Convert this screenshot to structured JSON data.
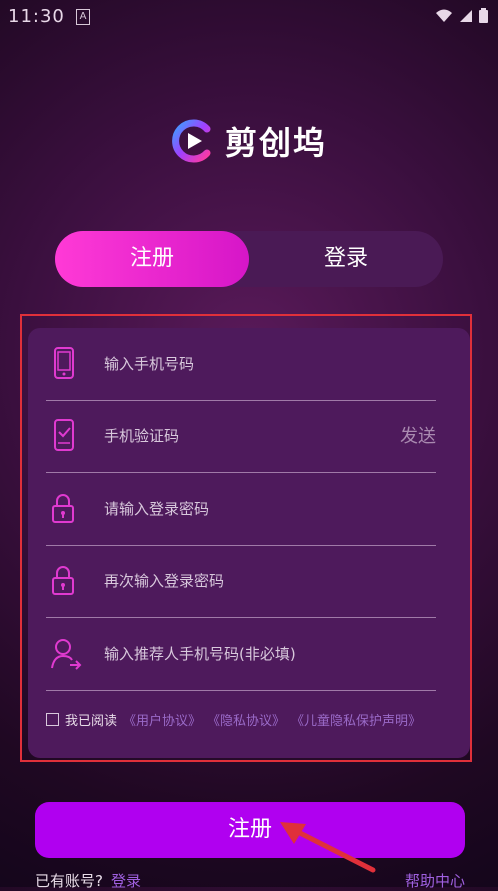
{
  "status_bar": {
    "time": "11:30",
    "notif_letter": "A"
  },
  "app": {
    "name": "剪创坞"
  },
  "tabs": {
    "register": "注册",
    "login": "登录"
  },
  "form": {
    "phone_placeholder": "输入手机号码",
    "code_placeholder": "手机验证码",
    "send_label": "发送",
    "password_placeholder": "请输入登录密码",
    "confirm_password_placeholder": "再次输入登录密码",
    "referrer_placeholder": "输入推荐人手机号码(非必填)"
  },
  "agreement": {
    "prefix": "我已阅读",
    "user_agreement": "《用户协议》",
    "privacy_agreement": "《隐私协议》",
    "child_privacy": "《儿童隐私保护声明》"
  },
  "submit_label": "注册",
  "footer": {
    "have_account": "已有账号?",
    "login": "登录",
    "help": "帮助中心"
  },
  "colors": {
    "accent_pink": "#ff3ad6",
    "submit_purple": "#b000f0",
    "highlight_red": "#e0303a"
  }
}
